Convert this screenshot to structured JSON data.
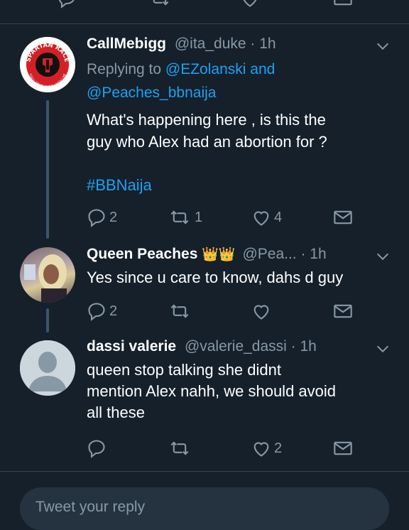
{
  "tweets": [
    {
      "name": "CallMebigg",
      "handle": "@ita_duke",
      "time": "· 1h",
      "replying_prefix": "Replying to",
      "replying_users": "@EZolanski and",
      "replying_users2": "@Peaches_bbnaija",
      "text_lines": [
        "What's happening here , is this the",
        "guy who Alex had an abortion for ?"
      ],
      "hashtag": "#BBNaija",
      "avatar_text": {
        "top": "SPARTAN RACE",
        "bottom": "YOU'LL KNOW AT THE FINISH LINE"
      },
      "counts": {
        "reply": "2",
        "retweet": "1",
        "like": "4"
      }
    },
    {
      "name": "Queen Peaches",
      "name_emoji": "👑👑",
      "handle": "@Pea...",
      "time": "· 1h",
      "text_lines": [
        "Yes since u care to know, dahs d guy"
      ],
      "counts": {
        "reply": "2",
        "retweet": "",
        "like": ""
      }
    },
    {
      "name": "dassi valerie",
      "handle": "@valerie_dassi",
      "time": "· 1h",
      "text_lines": [
        "queen stop talking she didnt",
        "mention Alex nahh, we should avoid",
        "all these"
      ],
      "counts": {
        "reply": "",
        "retweet": "",
        "like": "2"
      }
    }
  ],
  "reply_box": {
    "placeholder": "Tweet your reply"
  },
  "colors": {
    "background": "#15202b",
    "accent": "#1da1f2",
    "muted": "#8899a6",
    "divider": "#38444d"
  },
  "icons": [
    "reply-icon",
    "retweet-icon",
    "like-icon",
    "share-icon",
    "chevron-down-icon"
  ]
}
